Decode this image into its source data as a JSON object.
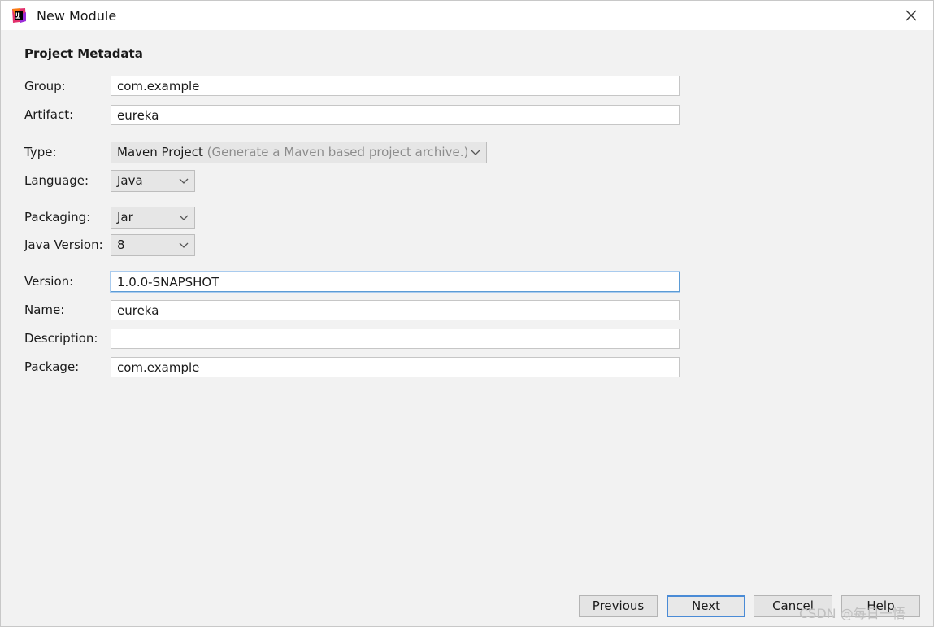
{
  "window": {
    "title": "New Module"
  },
  "section": {
    "title": "Project Metadata"
  },
  "fields": {
    "group": {
      "label": "Group:",
      "value": "com.example"
    },
    "artifact": {
      "label": "Artifact:",
      "value": "eureka"
    },
    "type": {
      "label": "Type:",
      "value": "Maven Project",
      "hint": "(Generate a Maven based project archive.)"
    },
    "language": {
      "label": "Language:",
      "value": "Java"
    },
    "packaging": {
      "label": "Packaging:",
      "value": "Jar"
    },
    "java_version": {
      "label": "Java Version:",
      "value": "8"
    },
    "version": {
      "label": "Version:",
      "value": "1.0.0-SNAPSHOT"
    },
    "name": {
      "label": "Name:",
      "value": "eureka"
    },
    "description": {
      "label": "Description:",
      "value": ""
    },
    "package": {
      "label": "Package:",
      "value": "com.example"
    }
  },
  "buttons": {
    "previous": "Previous",
    "next": "Next",
    "cancel": "Cancel",
    "help": "Help"
  },
  "watermark": "CSDN @每日一悟"
}
